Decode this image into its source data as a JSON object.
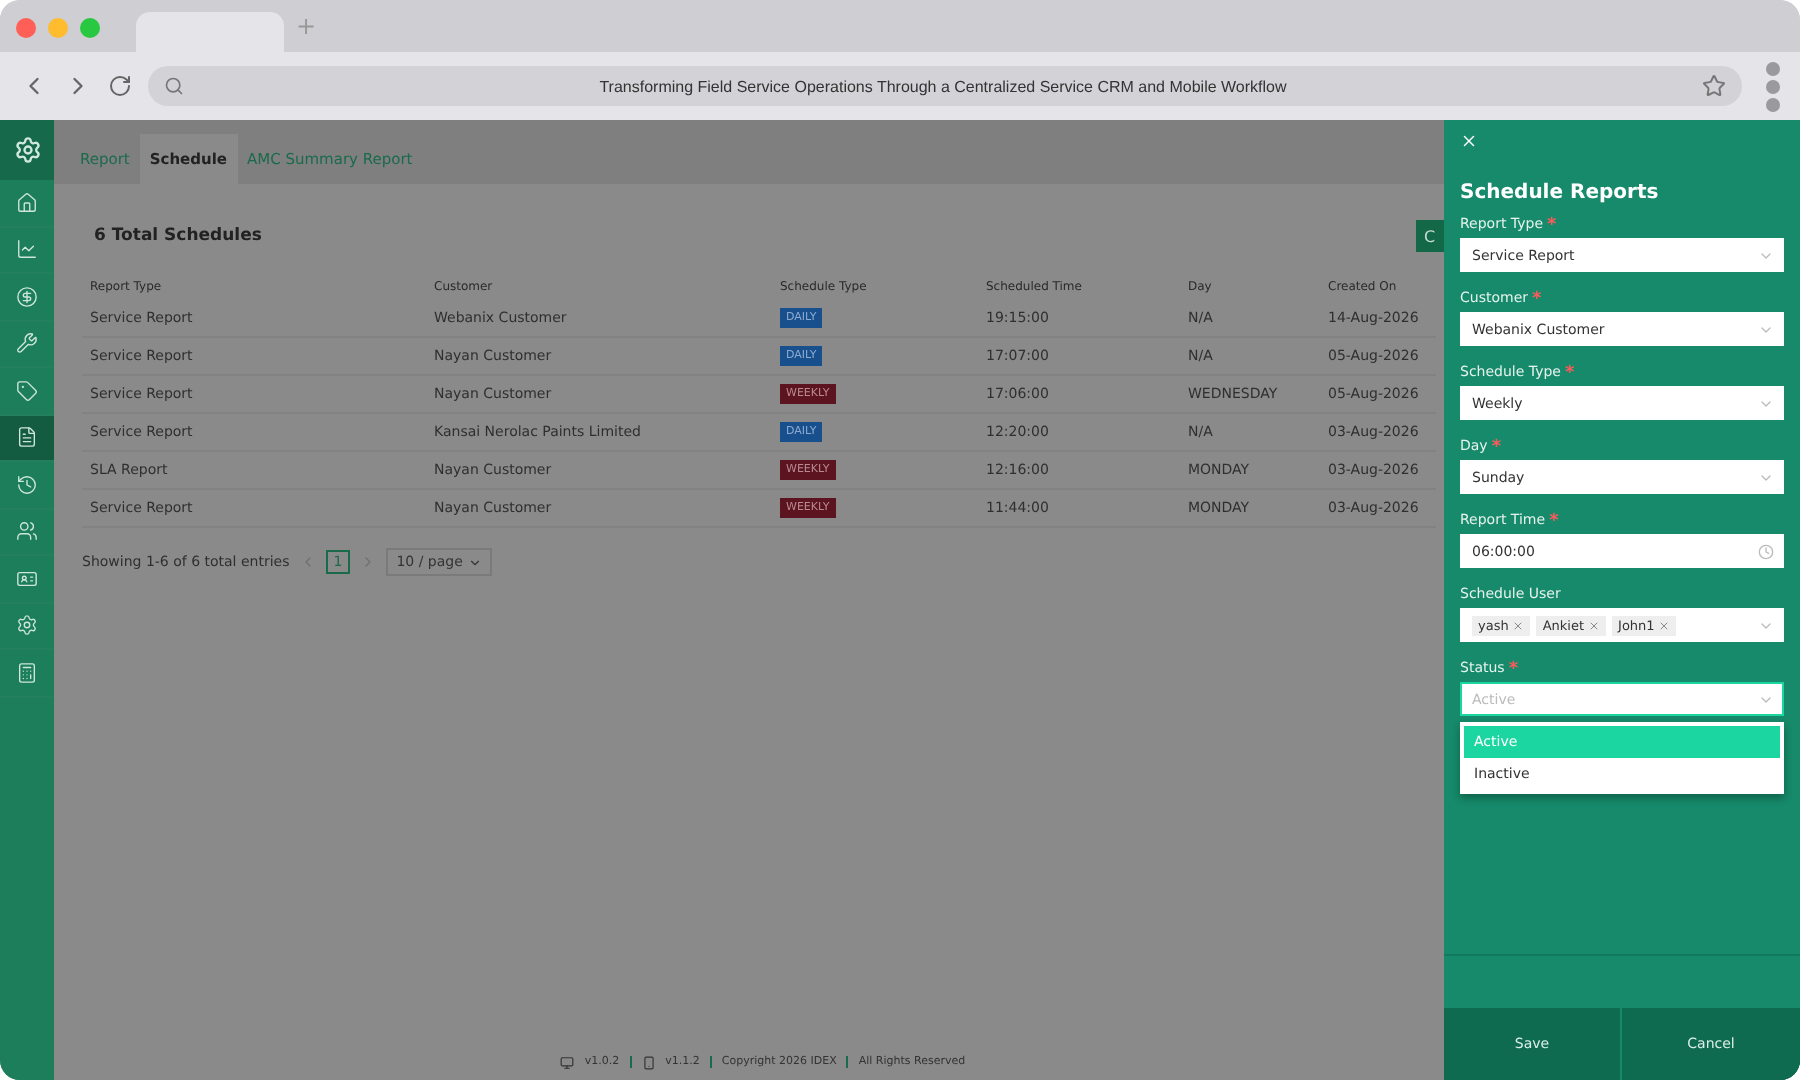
{
  "browser": {
    "new_tab": "+",
    "address": "Transforming Field Service Operations Through a Centralized Service CRM and Mobile Workflow"
  },
  "sidebar": {
    "items": [
      {
        "selected": false
      },
      {
        "selected": false
      },
      {
        "selected": false
      },
      {
        "selected": false
      },
      {
        "selected": false
      },
      {
        "selected": true
      },
      {
        "selected": false
      },
      {
        "selected": false
      },
      {
        "selected": false
      },
      {
        "selected": false
      },
      {
        "selected": false
      }
    ]
  },
  "tabs": [
    {
      "label": "Report",
      "selected": false
    },
    {
      "label": "Schedule",
      "selected": true
    },
    {
      "label": "AMC Summary Report",
      "selected": false
    }
  ],
  "table": {
    "title": "6 Total Schedules",
    "action_button": "C",
    "columns": [
      "Report Type",
      "Customer",
      "Schedule Type",
      "Scheduled Time",
      "Day",
      "Created On"
    ],
    "rows": [
      {
        "report_type": "Service Report",
        "customer": "Webanix Customer",
        "schedule_type": {
          "label": "DAILY",
          "kind": "daily"
        },
        "time": "19:15:00",
        "day": "N/A",
        "created": "14-Aug-2026"
      },
      {
        "report_type": "Service Report",
        "customer": "Nayan Customer",
        "schedule_type": {
          "label": "DAILY",
          "kind": "daily"
        },
        "time": "17:07:00",
        "day": "N/A",
        "created": "05-Aug-2026"
      },
      {
        "report_type": "Service Report",
        "customer": "Nayan Customer",
        "schedule_type": {
          "label": "WEEKLY",
          "kind": "weekly"
        },
        "time": "17:06:00",
        "day": "WEDNESDAY",
        "created": "05-Aug-2026"
      },
      {
        "report_type": "Service Report",
        "customer": "Kansai Nerolac Paints Limited",
        "schedule_type": {
          "label": "DAILY",
          "kind": "daily"
        },
        "time": "12:20:00",
        "day": "N/A",
        "created": "03-Aug-2026"
      },
      {
        "report_type": "SLA Report",
        "customer": "Nayan Customer",
        "schedule_type": {
          "label": "WEEKLY",
          "kind": "weekly"
        },
        "time": "12:16:00",
        "day": "MONDAY",
        "created": "03-Aug-2026"
      },
      {
        "report_type": "Service Report",
        "customer": "Nayan Customer",
        "schedule_type": {
          "label": "WEEKLY",
          "kind": "weekly"
        },
        "time": "11:44:00",
        "day": "MONDAY",
        "created": "03-Aug-2026"
      }
    ]
  },
  "pagination": {
    "summary": "Showing 1-6 of 6 total entries",
    "pages": [
      {
        "label": "1",
        "selected": true
      }
    ],
    "page_size": "10 / page"
  },
  "footer": {
    "web_version": "v1.0.2",
    "app_version": "v1.1.2",
    "copyright": "Copyright 2026 IDEX",
    "rights": "All Rights Reserved"
  },
  "drawer": {
    "title": "Schedule Reports",
    "fields": [
      {
        "kind": "select",
        "label": "Report Type",
        "required_mark": "*",
        "value": "Service Report"
      },
      {
        "kind": "select",
        "label": "Customer",
        "required_mark": "*",
        "value": "Webanix Customer"
      },
      {
        "kind": "select",
        "label": "Schedule Type",
        "required_mark": "*",
        "value": "Weekly"
      },
      {
        "kind": "select",
        "label": "Day",
        "required_mark": "*",
        "value": "Sunday"
      },
      {
        "kind": "time",
        "label": "Report Time",
        "required_mark": "*",
        "value": "06:00:00"
      },
      {
        "kind": "tags",
        "label": "Schedule User",
        "tags": [
          "yash",
          "Ankiet",
          "John1"
        ]
      },
      {
        "kind": "dropdown",
        "label": "Status",
        "required_mark": "*",
        "placeholder": "Active",
        "options": [
          {
            "label": "Active",
            "selected": true
          },
          {
            "label": "Inactive",
            "selected": false
          }
        ]
      }
    ],
    "buttons": [
      "Save",
      "Cancel"
    ]
  }
}
